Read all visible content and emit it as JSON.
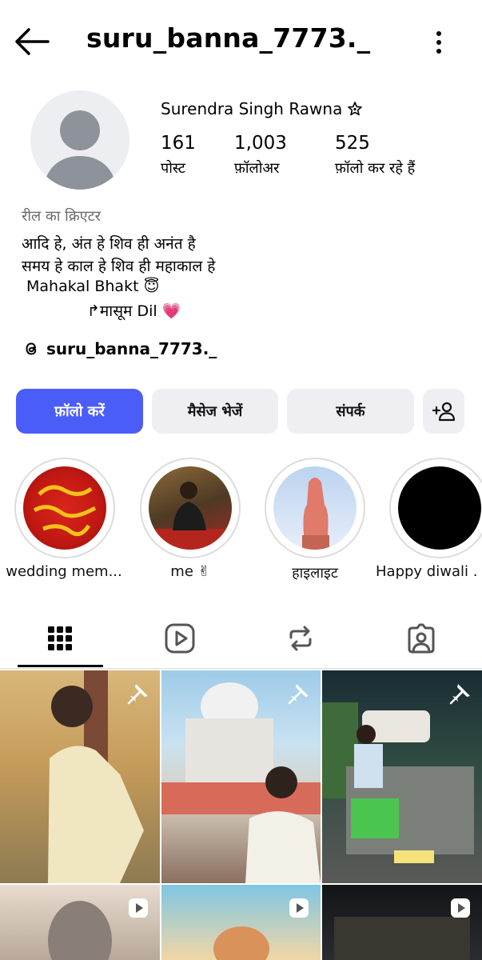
{
  "header": {
    "username": "suru_banna_7773._",
    "back_icon": "arrow-left-icon",
    "more_icon": "more-vertical-icon"
  },
  "profile": {
    "full_name": "Surendra Singh Rawna",
    "name_badge_icon": "star-outline-icon",
    "stats": [
      {
        "value": "161",
        "label": "पोस्ट"
      },
      {
        "value": "1,003",
        "label": "फ़ॉलोअर"
      },
      {
        "value": "525",
        "label": "फ़ॉलो कर रहे हैं"
      }
    ],
    "category": "रील का क्रिएटर",
    "bio_lines": [
      "आदि हे, अंत हे शिव ही अनंत है",
      "समय हे काल हे शिव ही महाकाल हे",
      "Mahakal Bhakt 😇",
      "↱मासूम Dil 💗"
    ],
    "threads_handle": "suru_banna_7773._"
  },
  "actions": {
    "follow": "फ़ॉलो करें",
    "message": "मैसेज भेजें",
    "contact": "संपर्क",
    "add_user_icon": "add-user-icon"
  },
  "highlights": [
    {
      "label": "wedding mem..."
    },
    {
      "label": "me ✌"
    },
    {
      "label": "हाइलाइट"
    },
    {
      "label": "Happy diwali ."
    }
  ],
  "tabs": [
    {
      "name": "grid",
      "icon": "grid-icon",
      "active": true
    },
    {
      "name": "reels",
      "icon": "reels-icon",
      "active": false
    },
    {
      "name": "reposts",
      "icon": "repost-icon",
      "active": false
    },
    {
      "name": "tagged",
      "icon": "tagged-icon",
      "active": false
    }
  ],
  "grid": [
    {
      "badge": "pin-icon"
    },
    {
      "badge": "pin-icon"
    },
    {
      "badge": "pin-icon"
    },
    {
      "badge": "play-icon"
    },
    {
      "badge": "play-icon"
    },
    {
      "badge": "play-icon"
    }
  ],
  "colors": {
    "accent": "#4a5df9",
    "button_bg": "#efeff3",
    "muted_text": "#6b6b6b"
  }
}
